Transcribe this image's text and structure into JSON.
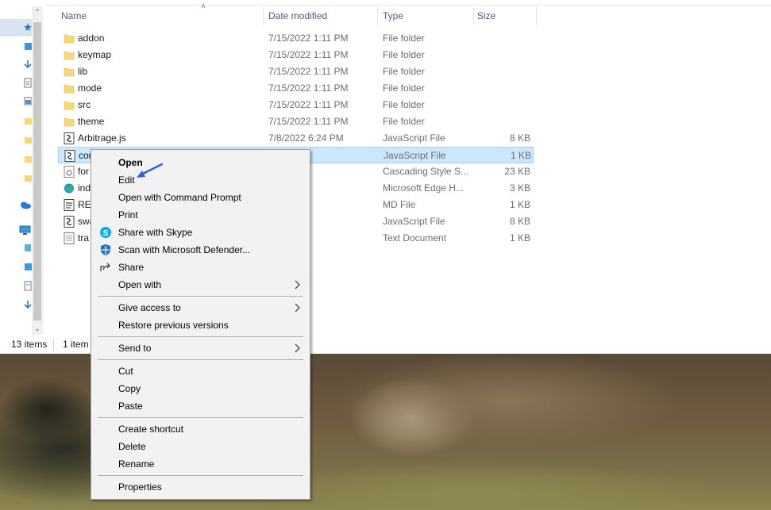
{
  "columns": {
    "name": "Name",
    "date_modified": "Date modified",
    "type": "Type",
    "size": "Size"
  },
  "files": [
    {
      "name": "addon",
      "date": "7/15/2022 1:11 PM",
      "type": "File folder",
      "size": "",
      "icon": "folder-icon"
    },
    {
      "name": "keymap",
      "date": "7/15/2022 1:11 PM",
      "type": "File folder",
      "size": "",
      "icon": "folder-icon"
    },
    {
      "name": "lib",
      "date": "7/15/2022 1:11 PM",
      "type": "File folder",
      "size": "",
      "icon": "folder-icon"
    },
    {
      "name": "mode",
      "date": "7/15/2022 1:11 PM",
      "type": "File folder",
      "size": "",
      "icon": "folder-icon"
    },
    {
      "name": "src",
      "date": "7/15/2022 1:11 PM",
      "type": "File folder",
      "size": "",
      "icon": "folder-icon"
    },
    {
      "name": "theme",
      "date": "7/15/2022 1:11 PM",
      "type": "File folder",
      "size": "",
      "icon": "folder-icon"
    },
    {
      "name": "Arbitrage.js",
      "date": "7/8/2022 6:24 PM",
      "type": "JavaScript File",
      "size": "8 KB",
      "icon": "js-file-icon"
    },
    {
      "name": "cor",
      "date": "8:05 AM",
      "type": "JavaScript File",
      "size": "1 KB",
      "icon": "js-file-icon",
      "selected": true
    },
    {
      "name": "for",
      "date": "24 PM",
      "type": "Cascading Style S...",
      "size": "23 KB",
      "icon": "css-file-icon"
    },
    {
      "name": "ind",
      "date": "1:00 PM",
      "type": "Microsoft Edge H...",
      "size": "3 KB",
      "icon": "edge-file-icon"
    },
    {
      "name": "REA",
      "date": "1:10 PM",
      "type": "MD File",
      "size": "1 KB",
      "icon": "md-file-icon"
    },
    {
      "name": "swa",
      "date": "24 PM",
      "type": "JavaScript File",
      "size": "8 KB",
      "icon": "js-file-icon"
    },
    {
      "name": "tra",
      "date": "24 PM",
      "type": "Text Document",
      "size": "1 KB",
      "icon": "text-file-icon"
    }
  ],
  "status": {
    "item_count": "13 items",
    "selected_count": "1 item"
  },
  "context_menu": {
    "open": "Open",
    "edit": "Edit",
    "open_cmd": "Open with Command Prompt",
    "print": "Print",
    "share_skype": "Share with Skype",
    "scan_defender": "Scan with Microsoft Defender...",
    "share": "Share",
    "open_with": "Open with",
    "give_access": "Give access to",
    "restore_versions": "Restore previous versions",
    "send_to": "Send to",
    "cut": "Cut",
    "copy": "Copy",
    "paste": "Paste",
    "create_shortcut": "Create shortcut",
    "delete": "Delete",
    "rename": "Rename",
    "properties": "Properties"
  },
  "colors": {
    "selection": "#cce8ff",
    "menu_bg": "#f2f2f2",
    "annotation_arrow": "#2f5ee8",
    "folder": "#f8d775"
  }
}
